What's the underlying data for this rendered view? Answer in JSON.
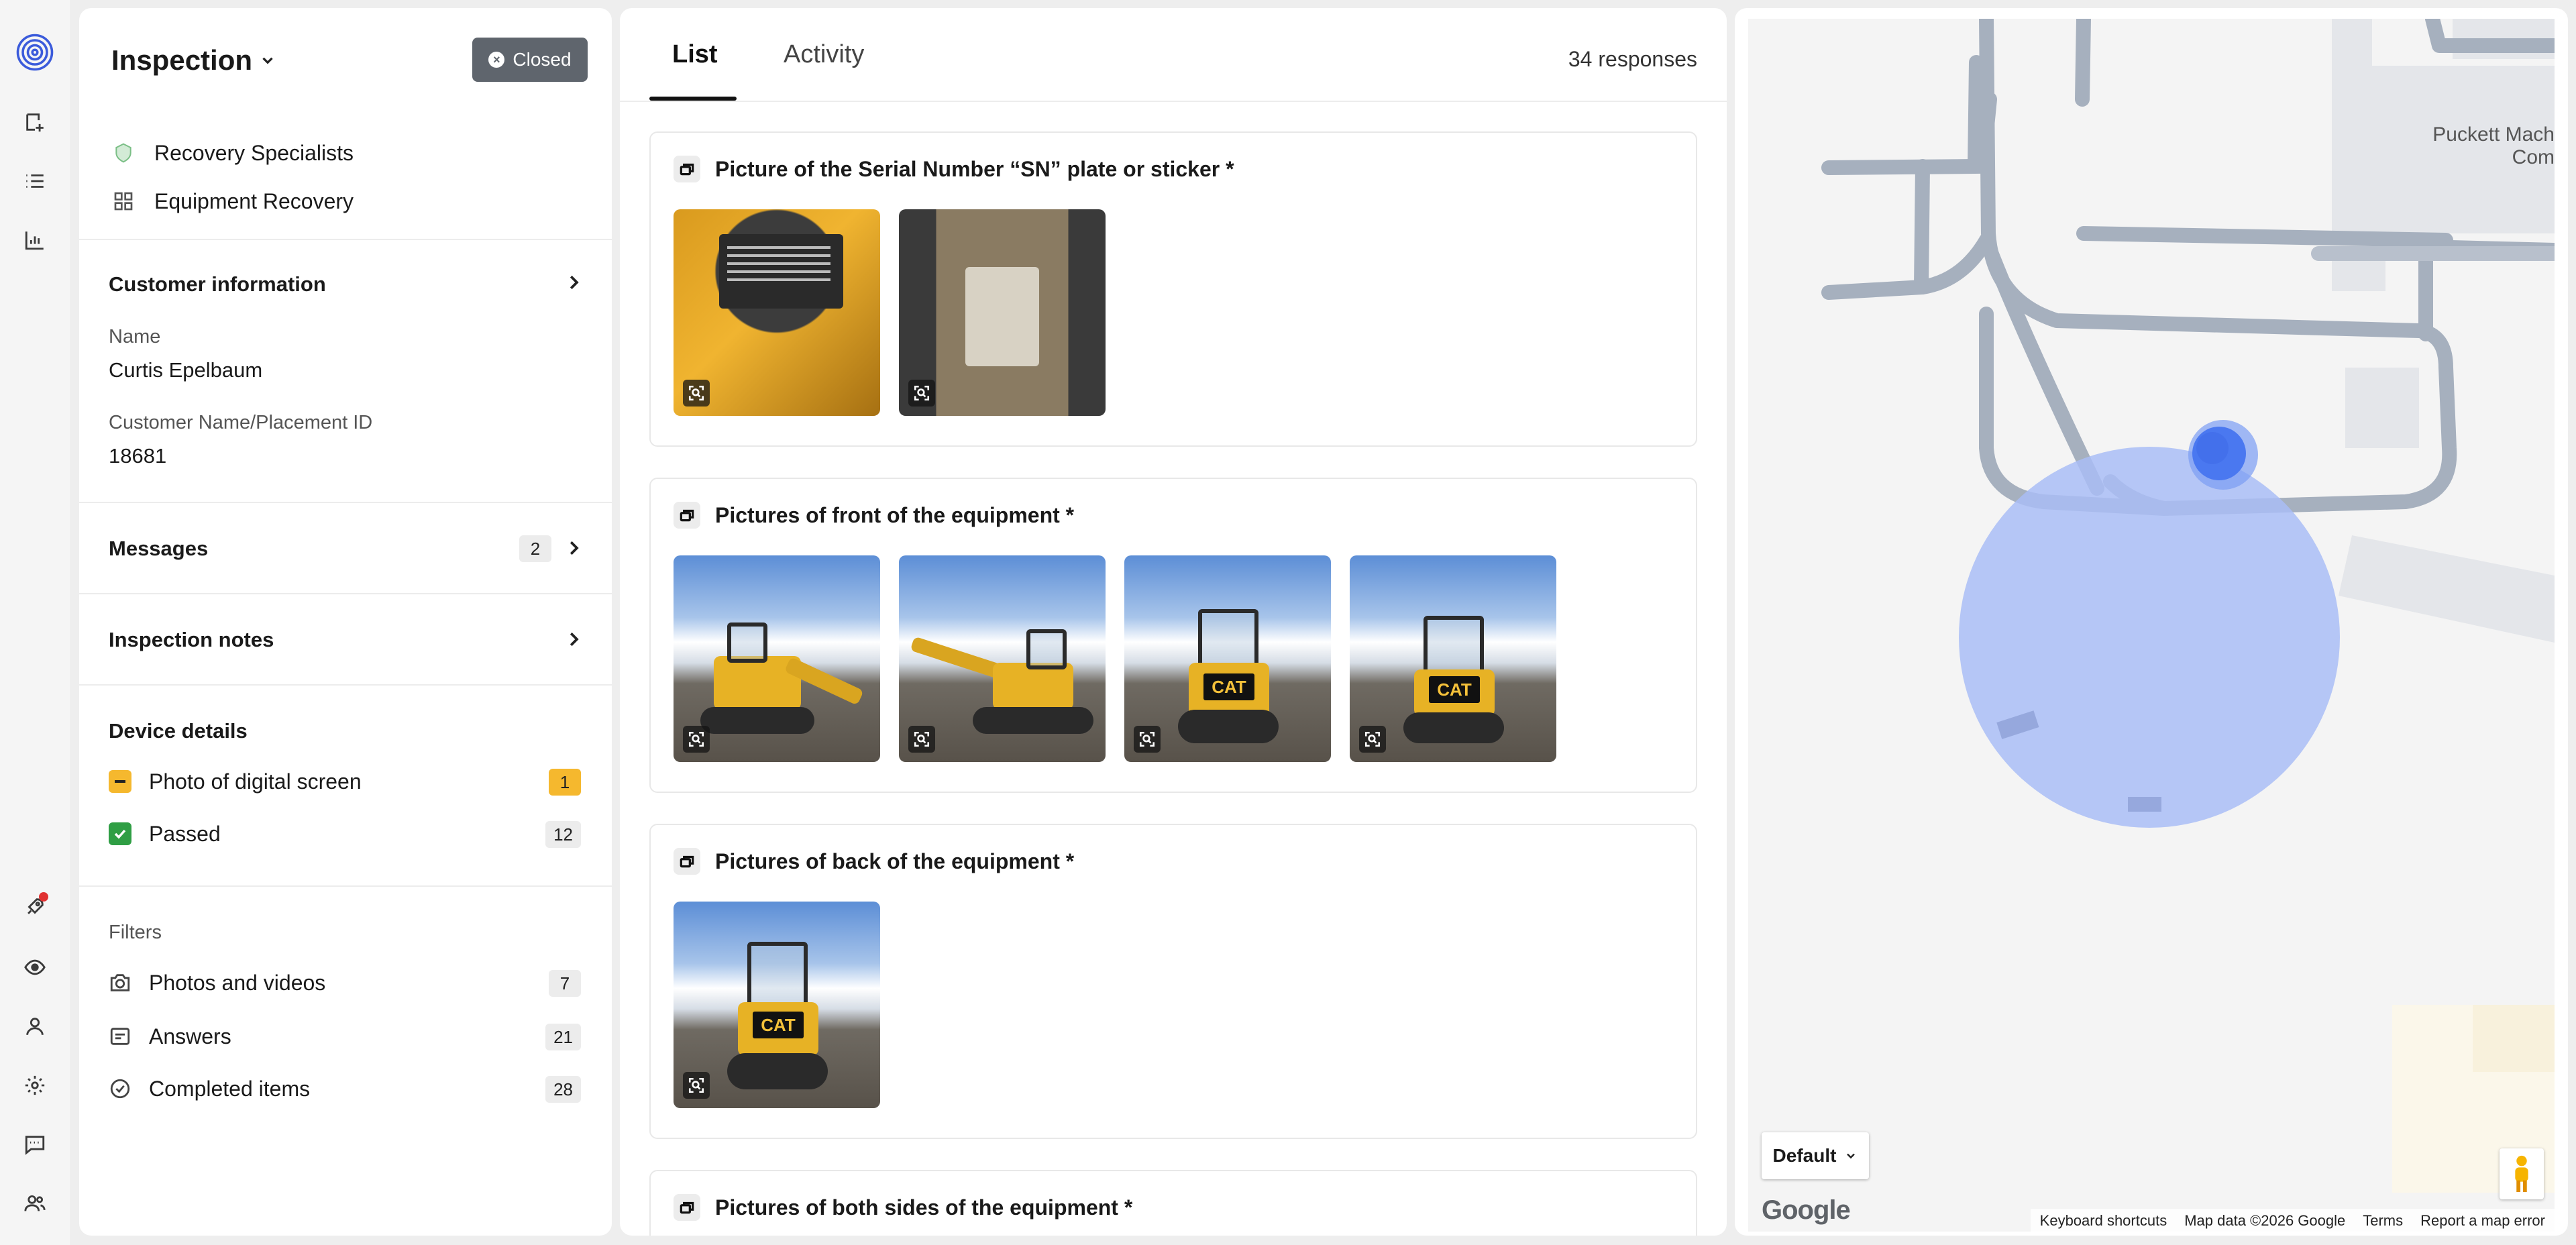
{
  "sidebar": {
    "title": "Inspection",
    "status_label": "Closed",
    "team": "Recovery Specialists",
    "template": "Equipment Recovery",
    "customer_info": {
      "title": "Customer information",
      "name_label": "Name",
      "name_value": "Curtis Epelbaum",
      "placement_label": "Customer Name/Placement ID",
      "placement_value": "18681"
    },
    "messages": {
      "title": "Messages",
      "count": "2"
    },
    "inspection_notes": {
      "title": "Inspection notes"
    },
    "device_details": {
      "title": "Device details",
      "items": [
        {
          "label": "Photo of digital screen",
          "count": "1",
          "state": "warning"
        },
        {
          "label": "Passed",
          "count": "12",
          "state": "passed"
        }
      ]
    },
    "filters": {
      "title": "Filters",
      "items": [
        {
          "label": "Photos and videos",
          "count": "7",
          "icon": "camera-icon"
        },
        {
          "label": "Answers",
          "count": "21",
          "icon": "answers-icon"
        },
        {
          "label": "Completed items",
          "count": "28",
          "icon": "check-circle-icon"
        }
      ]
    }
  },
  "main": {
    "tabs": [
      {
        "label": "List",
        "active": true
      },
      {
        "label": "Activity",
        "active": false
      }
    ],
    "responses": "34 responses",
    "cards": [
      {
        "title": "Picture of the Serial Number “SN” plate or sticker *",
        "photos": 2
      },
      {
        "title": "Pictures of front of the equipment *",
        "photos": 4
      },
      {
        "title": "Pictures of back of the equipment *",
        "photos": 1
      },
      {
        "title": "Pictures of both sides of the equipment *",
        "photos": 0
      }
    ],
    "cat_logo": "CAT"
  },
  "map": {
    "place_label_line1": "Puckett Mach",
    "place_label_line2": "Com",
    "map_type": "Default",
    "google_logo": "Google",
    "attribution": {
      "shortcuts": "Keyboard shortcuts",
      "data": "Map data ©2026 Google",
      "terms": "Terms",
      "report": "Report a map error"
    },
    "colors": {
      "accuracy_circle": "#a9bdf6",
      "location_dot": "#4a78f0",
      "roads": "#a6b0be"
    }
  },
  "colors": {
    "brand": "#3b5bdb",
    "warning": "#f5b82e",
    "passed": "#2f9e44",
    "closed_button": "#5f656d"
  }
}
